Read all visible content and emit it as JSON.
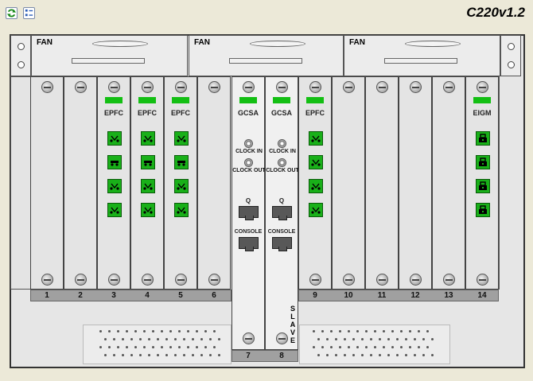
{
  "toolbar": {
    "refresh_title": "Refresh",
    "properties_title": "Properties"
  },
  "title": "C220v1.2",
  "fans": [
    {
      "label": "FAN"
    },
    {
      "label": "FAN"
    },
    {
      "label": "FAN"
    }
  ],
  "slots": [
    {
      "number": "1",
      "card": ""
    },
    {
      "number": "2",
      "card": ""
    },
    {
      "number": "3",
      "card": "EPFC"
    },
    {
      "number": "4",
      "card": "EPFC"
    },
    {
      "number": "5",
      "card": "EPFC"
    },
    {
      "number": "6",
      "card": ""
    },
    {
      "number": "7",
      "card": "GCSA",
      "clock_in": "CLOCK IN",
      "clock_out": "CLOCK OUT",
      "q": "Q",
      "console": "CONSOLE"
    },
    {
      "number": "8",
      "card": "GCSA",
      "clock_in": "CLOCK IN",
      "clock_out": "CLOCK OUT",
      "q": "Q",
      "console": "CONSOLE",
      "role": "SLAVE"
    },
    {
      "number": "9",
      "card": "EPFC"
    },
    {
      "number": "10",
      "card": ""
    },
    {
      "number": "11",
      "card": ""
    },
    {
      "number": "12",
      "card": ""
    },
    {
      "number": "13",
      "card": ""
    },
    {
      "number": "14",
      "card": "EIGM"
    }
  ],
  "colors": {
    "led": "#13bf13",
    "port": "#19b019",
    "chassis": "#e6e6e6"
  },
  "icons": {
    "epfc_port": "fiber-port-icon",
    "eigm_port": "gbic-port-icon"
  }
}
